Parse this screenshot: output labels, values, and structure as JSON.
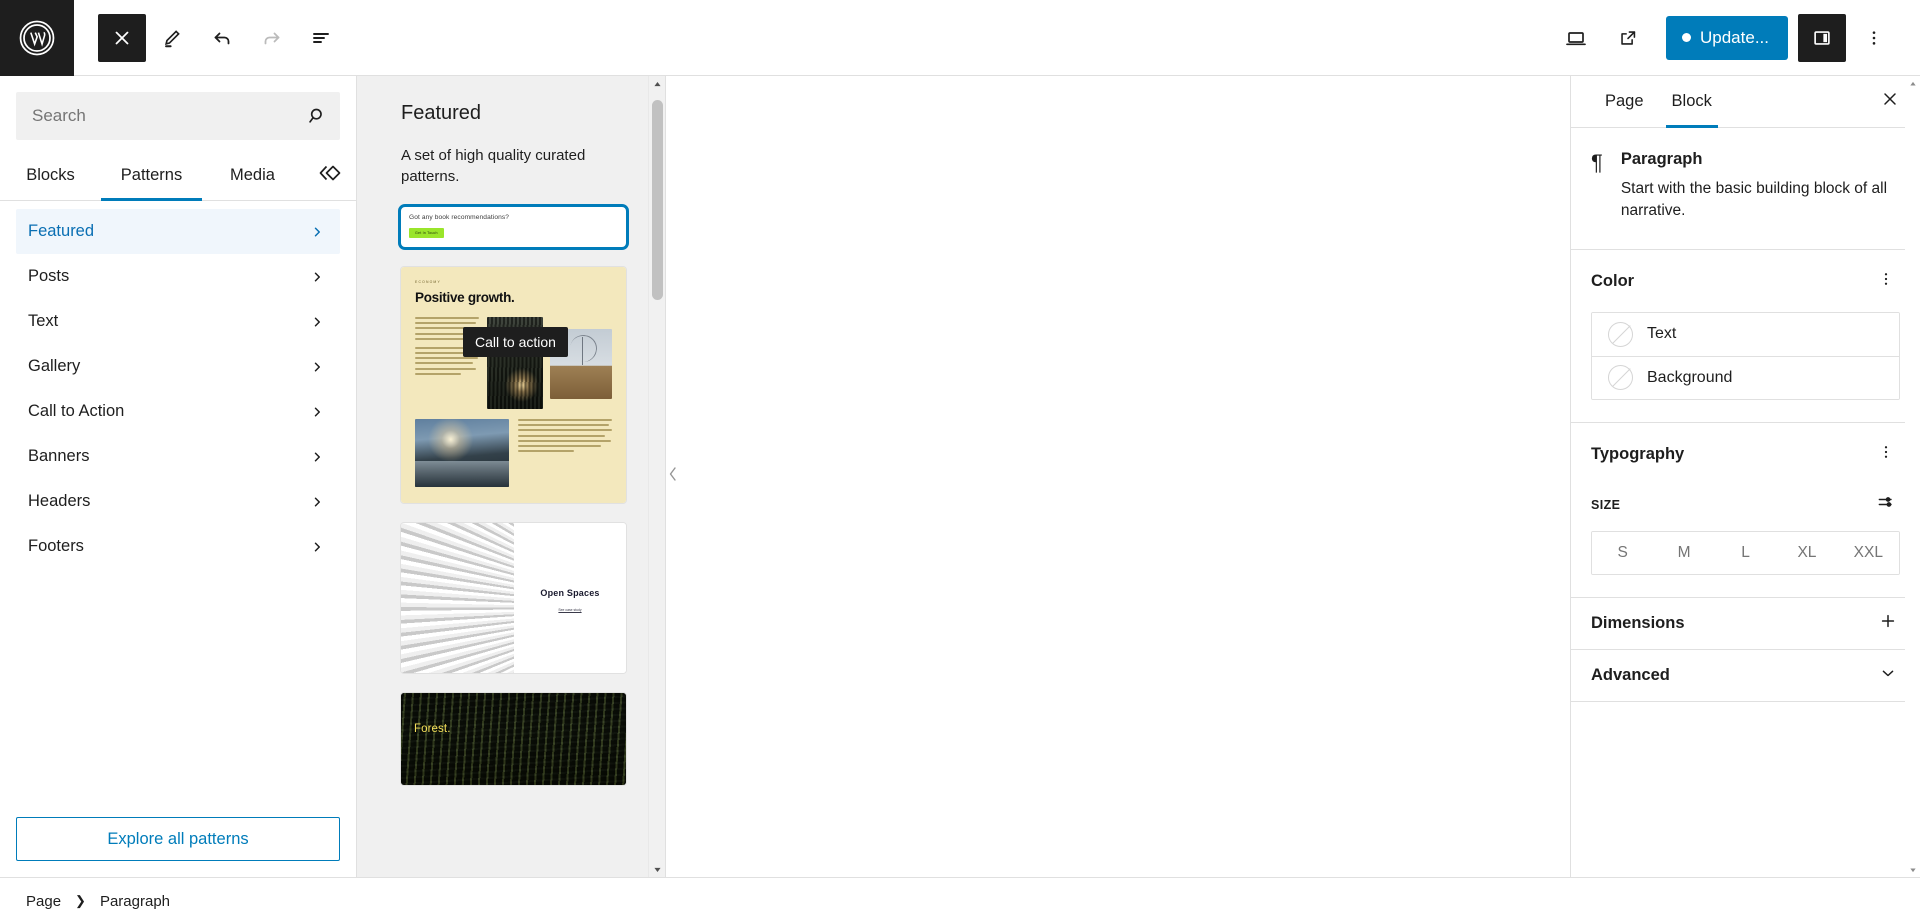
{
  "topbar": {
    "logo_icon": "wordpress-logo-icon",
    "close_icon": "close-icon",
    "edit_icon": "pencil-edit-icon",
    "undo_icon": "undo-icon",
    "redo_icon": "redo-icon",
    "list_view_icon": "list-view-icon",
    "preview_icon": "desktop-preview-icon",
    "view_site_icon": "external-link-icon",
    "update_label": "Update...",
    "settings_toggle_icon": "sidebar-toggle-icon",
    "options_icon": "three-dots-vertical-icon",
    "accent_color": "#007cba",
    "dark_color": "#1e1e1e"
  },
  "inserter": {
    "search": {
      "value": "",
      "placeholder": "Search",
      "icon": "search-icon"
    },
    "tabs": [
      {
        "label": "Blocks",
        "active": false
      },
      {
        "label": "Patterns",
        "active": true
      },
      {
        "label": "Media",
        "active": false
      }
    ],
    "media_toggle_icon": "double-chevron-diamond-icon",
    "categories": [
      {
        "label": "Featured",
        "selected": true
      },
      {
        "label": "Posts",
        "selected": false
      },
      {
        "label": "Text",
        "selected": false
      },
      {
        "label": "Gallery",
        "selected": false
      },
      {
        "label": "Call to Action",
        "selected": false
      },
      {
        "label": "Banners",
        "selected": false
      },
      {
        "label": "Headers",
        "selected": false
      },
      {
        "label": "Footers",
        "selected": false
      }
    ],
    "explore_label": "Explore all patterns"
  },
  "preview": {
    "title": "Featured",
    "subtitle": "A set of high quality curated patterns.",
    "tooltip": "Call to action",
    "patterns": [
      {
        "name": "call-to-action",
        "heading": "Got any book recommendations?",
        "button_label": "Get In Touch",
        "button_color": "#9ae52b",
        "focused": true
      },
      {
        "name": "positive-growth",
        "kicker": "ECONOMY",
        "heading": "Positive growth.",
        "background_color": "#f3e8bd",
        "focused": false
      },
      {
        "name": "open-spaces",
        "heading": "Open Spaces",
        "link_label": "See case study",
        "focused": false
      },
      {
        "name": "forest",
        "heading": "Forest.",
        "heading_color": "#f5e05a",
        "focused": false
      }
    ],
    "scroll_up_icon": "chevron-up-icon",
    "scroll_down_icon": "chevron-down-icon"
  },
  "canvas": {
    "collapse_icon": "chevron-left-icon"
  },
  "right_panel": {
    "tabs": [
      {
        "label": "Page",
        "active": false
      },
      {
        "label": "Block",
        "active": true
      }
    ],
    "close_icon": "close-icon",
    "block": {
      "icon": "paragraph-pilcrow-icon",
      "title": "Paragraph",
      "description": "Start with the basic building block of all narrative."
    },
    "color": {
      "title": "Color",
      "options_icon": "three-dots-vertical-icon",
      "rows": [
        {
          "label": "Text",
          "swatch_icon": "no-color-circle-icon"
        },
        {
          "label": "Background",
          "swatch_icon": "no-color-circle-icon"
        }
      ]
    },
    "typography": {
      "title": "Typography",
      "options_icon": "three-dots-vertical-icon",
      "size_label": "SIZE",
      "size_settings_icon": "sliders-icon",
      "sizes": [
        "S",
        "M",
        "L",
        "XL",
        "XXL"
      ],
      "selected_size": ""
    },
    "dimensions": {
      "title": "Dimensions",
      "icon": "plus-icon"
    },
    "advanced": {
      "title": "Advanced",
      "icon": "chevron-down-icon"
    },
    "scroll_up_icon": "chevron-up-icon",
    "scroll_down_icon": "chevron-down-icon"
  },
  "footer": {
    "breadcrumbs": [
      "Page",
      "Paragraph"
    ],
    "separator": "❯"
  }
}
